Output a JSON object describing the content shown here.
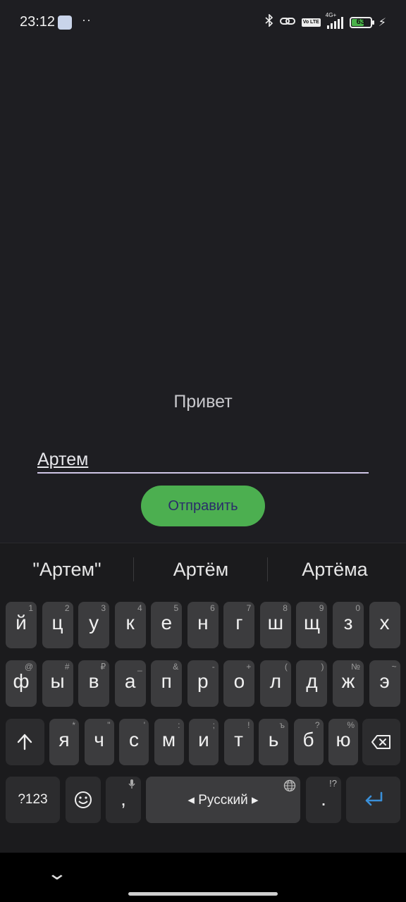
{
  "status_bar": {
    "time": "23:12",
    "dots": "··",
    "network": "4G+",
    "battery": "63",
    "volte": "Vo LTE"
  },
  "app": {
    "greeting": "Привет",
    "name_input_value": "Артем",
    "send_button": "Отправить",
    "accent_color": "#4caf50"
  },
  "keyboard": {
    "suggestions": [
      "\"Артем\"",
      "Артём",
      "Артёма"
    ],
    "rows": [
      [
        [
          "й",
          "1"
        ],
        [
          "ц",
          "2"
        ],
        [
          "у",
          "3"
        ],
        [
          "к",
          "4"
        ],
        [
          "е",
          "5"
        ],
        [
          "н",
          "6"
        ],
        [
          "г",
          "7"
        ],
        [
          "ш",
          "8"
        ],
        [
          "щ",
          "9"
        ],
        [
          "з",
          "0"
        ],
        [
          "х",
          ""
        ]
      ],
      [
        [
          "ф",
          "@"
        ],
        [
          "ы",
          "#"
        ],
        [
          "в",
          "₽"
        ],
        [
          "а",
          "_"
        ],
        [
          "п",
          "&"
        ],
        [
          "р",
          "-"
        ],
        [
          "о",
          "+"
        ],
        [
          "л",
          "("
        ],
        [
          "д",
          ")"
        ],
        [
          "ж",
          "№"
        ],
        [
          "э",
          "~"
        ]
      ],
      [
        [
          "я",
          "*"
        ],
        [
          "ч",
          "\""
        ],
        [
          "с",
          "'"
        ],
        [
          "м",
          ":"
        ],
        [
          "и",
          ";"
        ],
        [
          "т",
          "!"
        ],
        [
          "ь",
          "ъ"
        ],
        [
          "б",
          "?"
        ],
        [
          "ю",
          "%"
        ]
      ]
    ],
    "symbols_key": "?123",
    "comma_key": ",",
    "space_key": "Русский",
    "period_key": ".",
    "period_sub": "!?"
  }
}
